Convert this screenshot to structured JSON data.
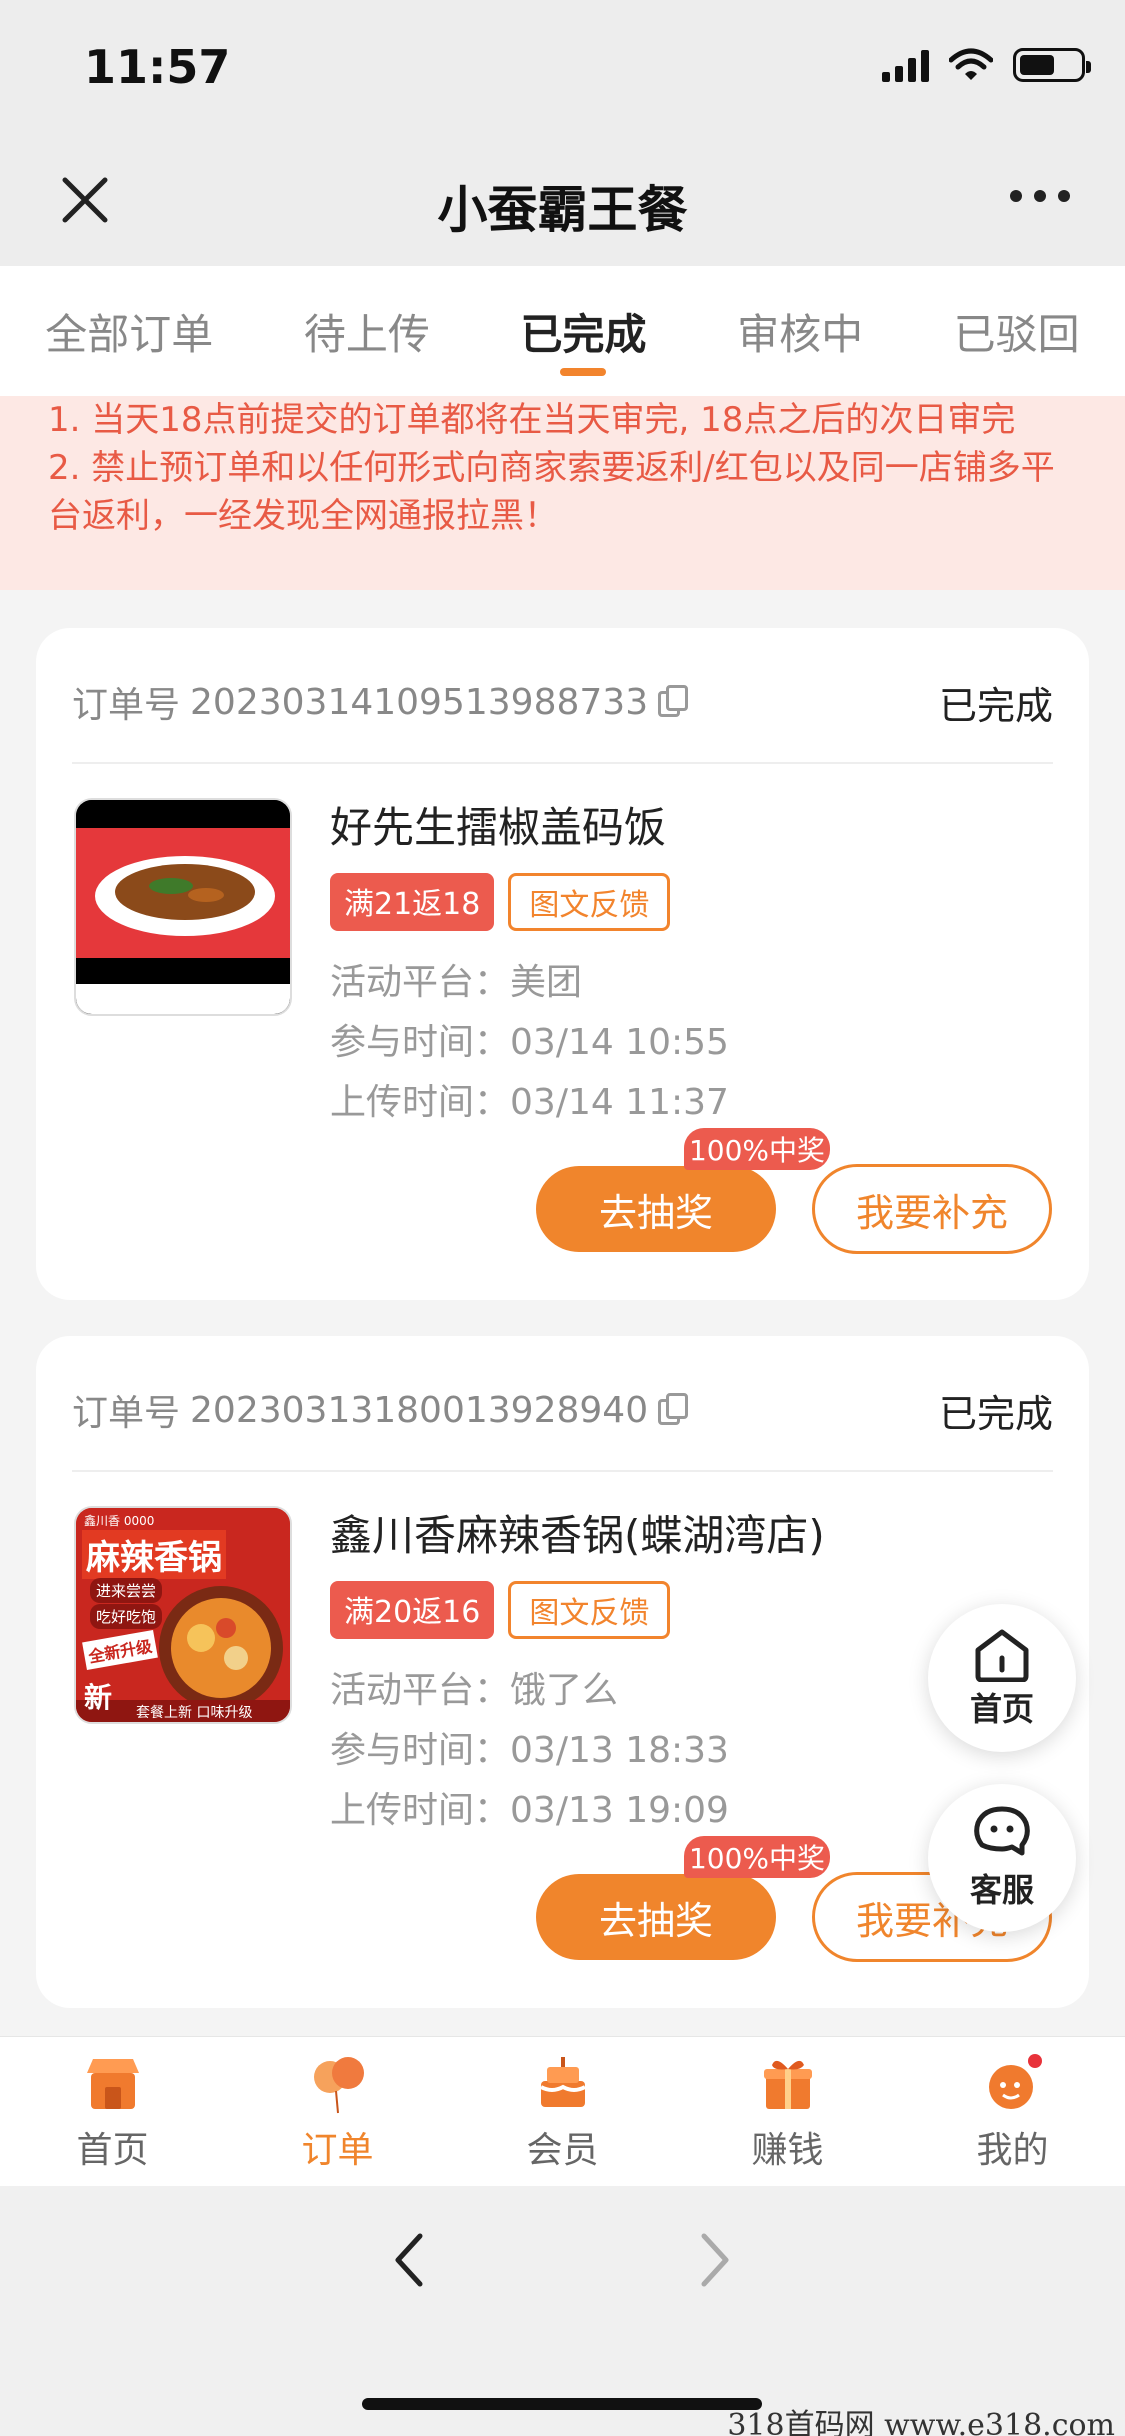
{
  "status_bar": {
    "time": "11:57"
  },
  "nav": {
    "title": "小蚕霸王餐"
  },
  "tabs": [
    {
      "label": "全部订单"
    },
    {
      "label": "待上传"
    },
    {
      "label": "已完成"
    },
    {
      "label": "审核中"
    },
    {
      "label": "已驳回"
    }
  ],
  "active_tab": "已完成",
  "notice": {
    "line1": "1. 当天18点前提交的订单都将在当天审完, 18点之后的次日审完",
    "line2": "2. 禁止预订单和以任何形式向商家索要返利/红包以及同一店铺多平台返利，一经发现全网通报拉黑！"
  },
  "orders": [
    {
      "order_label": "订单号",
      "order_no": "20230314109513988733",
      "status": "已完成",
      "shop": "好先生擂椒盖码饭",
      "badge_rebate": "满21返18",
      "badge_type": "图文反馈",
      "platform_label": "活动平台：",
      "platform": "美团",
      "join_label": "参与时间：",
      "join_time": "03/14 10:55",
      "upload_label": "上传时间：",
      "upload_time": "03/14 11:37",
      "tag": "100%中奖",
      "draw_btn": "去抽奖",
      "supp_btn": "我要补充"
    },
    {
      "order_label": "订单号",
      "order_no": "20230313180013928940",
      "status": "已完成",
      "shop": "鑫川香麻辣香锅(蝶湖湾店)",
      "badge_rebate": "满20返16",
      "badge_type": "图文反馈",
      "platform_label": "活动平台：",
      "platform": "饿了么",
      "join_label": "参与时间：",
      "join_time": "03/13 18:33",
      "upload_label": "上传时间：",
      "upload_time": "03/13 19:09",
      "tag": "100%中奖",
      "draw_btn": "去抽奖",
      "supp_btn": "我要补充",
      "thumb_text": "麻辣香锅",
      "thumb_sub": "全新升级",
      "thumb_new": "新",
      "thumb_bottom": "套餐上新 口味升级",
      "thumb_pill1": "进来尝尝",
      "thumb_pill2": "吃好吃饱",
      "thumb_topline": "鑫川香 0000"
    }
  ],
  "floating": {
    "home": "首页",
    "service": "客服"
  },
  "tabbar": [
    {
      "label": "首页",
      "icon": "store-icon"
    },
    {
      "label": "订单",
      "icon": "balloon-icon"
    },
    {
      "label": "会员",
      "icon": "cake-icon"
    },
    {
      "label": "赚钱",
      "icon": "gift-icon"
    },
    {
      "label": "我的",
      "icon": "mascot-icon"
    }
  ],
  "active_tabbar": "订单",
  "watermark": "318首码网  www.e318.com",
  "colors": {
    "accent": "#f0852c",
    "red": "#ec5b4e",
    "notice_bg": "#fde8e4"
  }
}
